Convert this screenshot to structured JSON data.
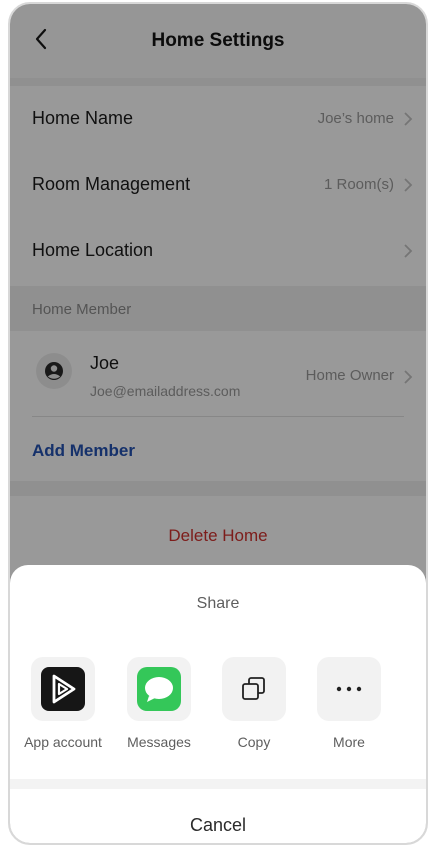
{
  "header": {
    "title": "Home Settings"
  },
  "settings": {
    "home_name": {
      "label": "Home Name",
      "value": "Joe’s home"
    },
    "room_management": {
      "label": "Room Management",
      "value": "1 Room(s)"
    },
    "home_location": {
      "label": "Home Location"
    }
  },
  "members": {
    "section_label": "Home Member",
    "member": {
      "name": "Joe",
      "email": "Joe@emailaddress.com",
      "role": "Home Owner"
    },
    "add_label": "Add Member"
  },
  "delete_label": "Delete Home",
  "share": {
    "title": "Share",
    "items": [
      {
        "label": "App account",
        "icon": "app-account-icon"
      },
      {
        "label": "Messages",
        "icon": "messages-icon"
      },
      {
        "label": "Copy",
        "icon": "copy-icon"
      },
      {
        "label": "More",
        "icon": "more-icon"
      }
    ],
    "cancel_label": "Cancel"
  },
  "colors": {
    "accent": "#2452b3",
    "danger": "#d0312d",
    "messages_green": "#34c759"
  }
}
